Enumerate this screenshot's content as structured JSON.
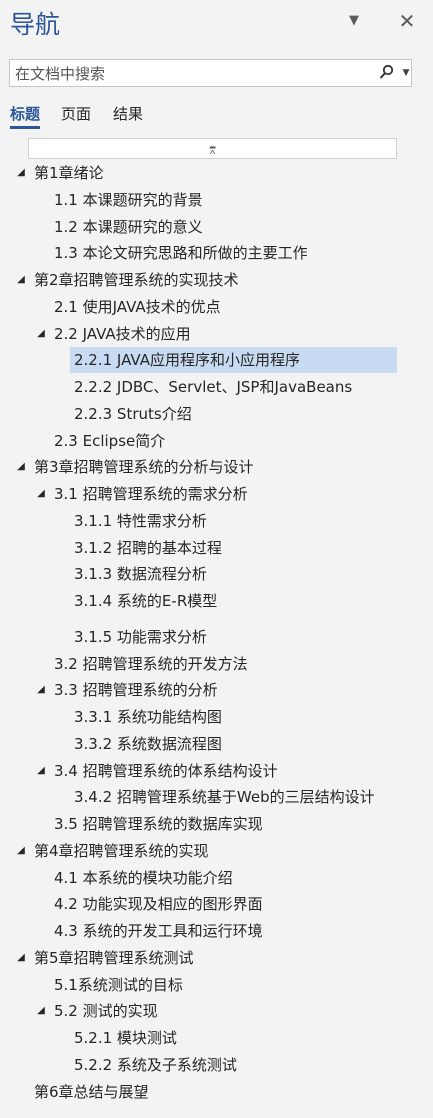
{
  "header": {
    "title": "导航"
  },
  "search": {
    "placeholder": "在文档中搜索"
  },
  "tabs": [
    {
      "label": "标题",
      "active": true
    },
    {
      "label": "页面",
      "active": false
    },
    {
      "label": "结果",
      "active": false
    }
  ],
  "outline": [
    {
      "label": "第1章绪论",
      "level": 1,
      "expanded": true
    },
    {
      "label": "1.1 本课题研究的背景",
      "level": 2
    },
    {
      "label": "1.2 本课题研究的意义",
      "level": 2
    },
    {
      "label": "1.3 本论文研究思路和所做的主要工作",
      "level": 2
    },
    {
      "label": "第2章招聘管理系统的实现技术",
      "level": 1,
      "expanded": true
    },
    {
      "label": "2.1 使用JAVA技术的优点",
      "level": 2
    },
    {
      "label": "2.2 JAVA技术的应用",
      "level": 2,
      "expanded": true
    },
    {
      "label": "2.2.1 JAVA应用程序和小应用程序",
      "level": 3,
      "selected": true
    },
    {
      "label": "2.2.2 JDBC、Servlet、JSP和JavaBeans",
      "level": 3
    },
    {
      "label": "2.2.3 Struts介绍",
      "level": 3
    },
    {
      "label": "2.3 Eclipse简介",
      "level": 2
    },
    {
      "label": "第3章招聘管理系统的分析与设计",
      "level": 1,
      "expanded": true
    },
    {
      "label": "3.1 招聘管理系统的需求分析",
      "level": 2,
      "expanded": true
    },
    {
      "label": "3.1.1 特性需求分析",
      "level": 3
    },
    {
      "label": "3.1.2 招聘的基本过程",
      "level": 3
    },
    {
      "label": "3.1.3 数据流程分析",
      "level": 3
    },
    {
      "label": "3.1.4 系统的E-R模型",
      "level": 3
    },
    {
      "label": "3.1.5 功能需求分析",
      "level": 3
    },
    {
      "label": "3.2 招聘管理系统的开发方法",
      "level": 2
    },
    {
      "label": "3.3 招聘管理系统的分析",
      "level": 2,
      "expanded": true
    },
    {
      "label": "3.3.1 系统功能结构图",
      "level": 3
    },
    {
      "label": "3.3.2 系统数据流程图",
      "level": 3
    },
    {
      "label": "3.4 招聘管理系统的体系结构设计",
      "level": 2,
      "expanded": true
    },
    {
      "label": "3.4.2 招聘管理系统基于Web的三层结构设计",
      "level": 3
    },
    {
      "label": "3.5 招聘管理系统的数据库实现",
      "level": 2
    },
    {
      "label": "第4章招聘管理系统的实现",
      "level": 1,
      "expanded": true
    },
    {
      "label": "4.1 本系统的模块功能介绍",
      "level": 2
    },
    {
      "label": "4.2 功能实现及相应的图形界面",
      "level": 2
    },
    {
      "label": "4.3 系统的开发工具和运行环境",
      "level": 2
    },
    {
      "label": "第5章招聘管理系统测试",
      "level": 1,
      "expanded": true
    },
    {
      "label": "5.1系统测试的目标",
      "level": 2
    },
    {
      "label": "5.2 测试的实现",
      "level": 2,
      "expanded": true
    },
    {
      "label": "5.2.1 模块测试",
      "level": 3
    },
    {
      "label": "5.2.2 系统及子系统测试",
      "level": 3
    },
    {
      "label": "第6章总结与展望",
      "level": 1
    }
  ]
}
